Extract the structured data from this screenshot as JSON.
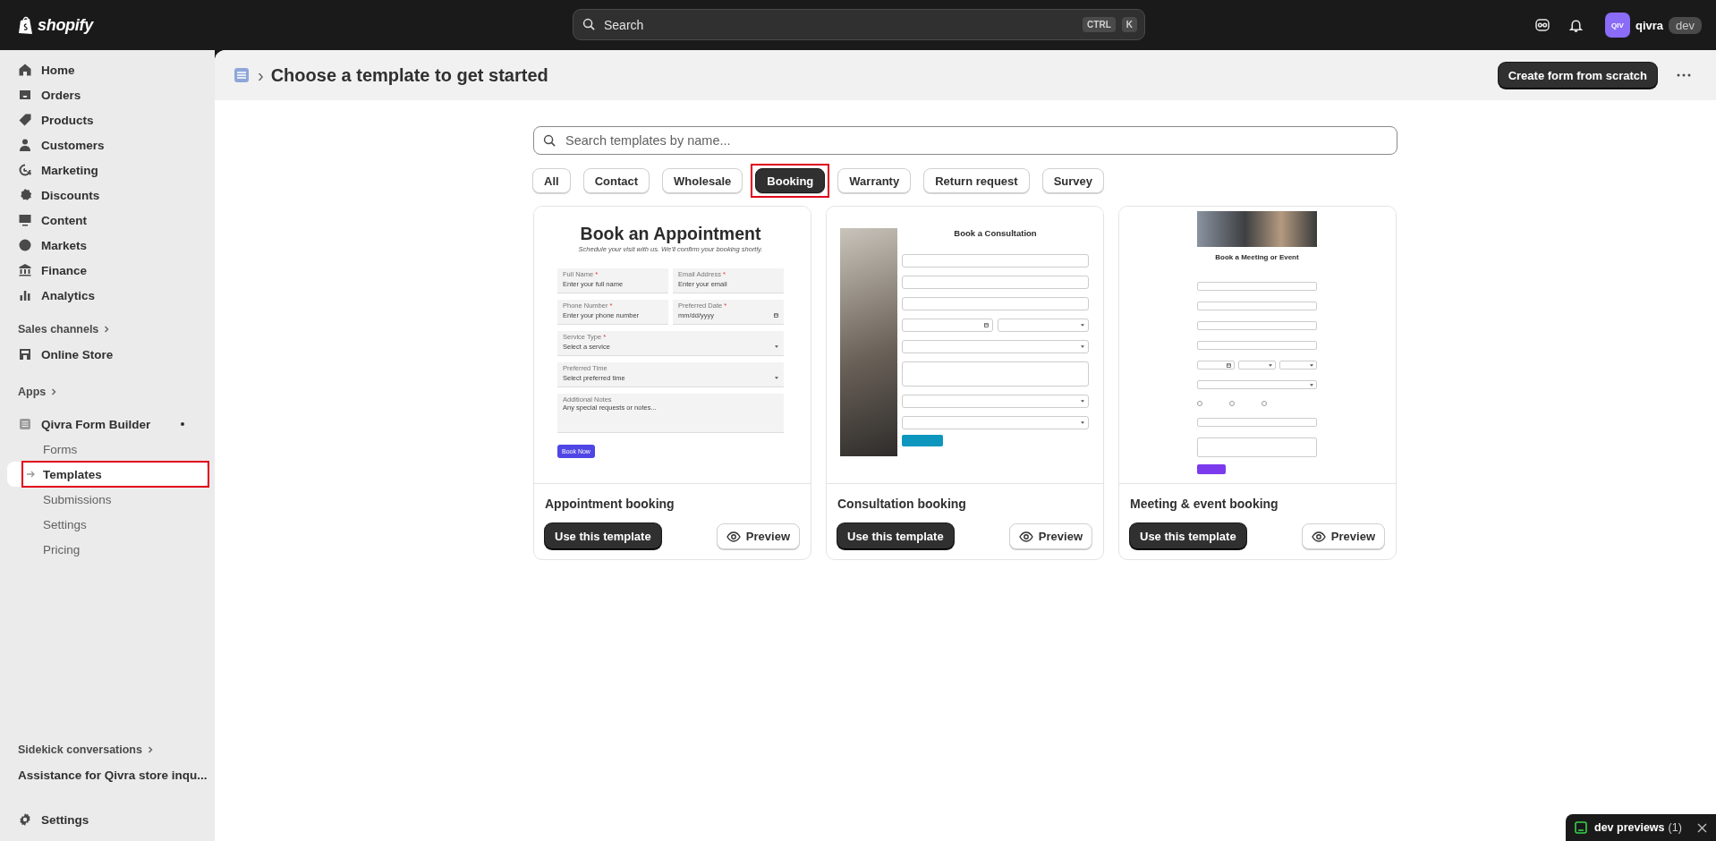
{
  "topbar": {
    "brand": "shopify",
    "search": {
      "placeholder": "Search",
      "keys": [
        "CTRL",
        "K"
      ]
    },
    "avatar": "QIV",
    "store": "qivra",
    "store_badge": "dev"
  },
  "sidebar": {
    "nav": [
      {
        "label": "Home",
        "selected": false
      },
      {
        "label": "Orders",
        "selected": false
      },
      {
        "label": "Products",
        "selected": false
      },
      {
        "label": "Customers",
        "selected": false
      },
      {
        "label": "Marketing",
        "selected": false
      },
      {
        "label": "Discounts",
        "selected": false
      },
      {
        "label": "Content",
        "selected": false
      },
      {
        "label": "Markets",
        "selected": false
      },
      {
        "label": "Finance",
        "selected": false
      },
      {
        "label": "Analytics",
        "selected": false
      }
    ],
    "sales_channels": {
      "heading": "Sales channels",
      "items": [
        {
          "label": "Online Store",
          "selected": false
        }
      ]
    },
    "apps": {
      "heading": "Apps",
      "app": {
        "label": "Qivra Form Builder",
        "pinned": true,
        "children": [
          {
            "label": "Forms",
            "selected": false,
            "highlighted": false
          },
          {
            "label": "Templates",
            "selected": true,
            "highlighted": true
          },
          {
            "label": "Submissions",
            "selected": false,
            "highlighted": false
          },
          {
            "label": "Settings",
            "selected": false,
            "highlighted": false
          },
          {
            "label": "Pricing",
            "selected": false,
            "highlighted": false
          }
        ]
      }
    },
    "sidekick": {
      "heading": "Sidekick conversations",
      "items": [
        "Assistance for Qivra store inqu..."
      ]
    },
    "settings": "Settings"
  },
  "page": {
    "breadcrumb_separator": "›",
    "title": "Choose a template to get started",
    "primary_action": "Create form from scratch"
  },
  "search": {
    "placeholder": "Search templates by name..."
  },
  "filters": [
    {
      "label": "All",
      "selected": false,
      "highlighted": false
    },
    {
      "label": "Contact",
      "selected": false,
      "highlighted": false
    },
    {
      "label": "Wholesale",
      "selected": false,
      "highlighted": false
    },
    {
      "label": "Booking",
      "selected": true,
      "highlighted": true
    },
    {
      "label": "Warranty",
      "selected": false,
      "highlighted": false
    },
    {
      "label": "Return request",
      "selected": false,
      "highlighted": false
    },
    {
      "label": "Survey",
      "selected": false,
      "highlighted": false
    }
  ],
  "templates": [
    {
      "name": "Appointment booking",
      "use_label": "Use this template",
      "preview_label": "Preview",
      "preview": {
        "kind": "filled",
        "title": "Book an Appointment",
        "subtitle": "Schedule your visit with us. We'll confirm your booking shortly.",
        "rows": [
          [
            {
              "kind": "input",
              "label": "Full Name",
              "mark": "*",
              "placeholder": "Enter your full name"
            },
            {
              "kind": "input",
              "label": "Email Address",
              "mark": "*",
              "placeholder": "Enter your email"
            }
          ],
          [
            {
              "kind": "input",
              "label": "Phone Number",
              "mark": "*",
              "placeholder": "Enter your phone number"
            },
            {
              "kind": "date",
              "label": "Preferred Date",
              "mark": "*",
              "placeholder": "mm/dd/yyyy"
            }
          ],
          [
            {
              "kind": "select",
              "label": "Service Type",
              "mark": "*",
              "placeholder": "Select a service"
            }
          ],
          [
            {
              "kind": "select",
              "label": "Preferred Time",
              "placeholder": "Select preferred time"
            }
          ],
          [
            {
              "kind": "textarea",
              "label": "Additional Notes",
              "placeholder": "Any special requests or notes..."
            }
          ]
        ],
        "button": {
          "label": "Book Now",
          "color": "#4f46e5"
        }
      }
    },
    {
      "name": "Consultation booking",
      "use_label": "Use this template",
      "preview_label": "Preview",
      "preview": {
        "kind": "side_photo",
        "title": "Book a Consultation",
        "rows": [
          [
            {
              "kind": "input"
            }
          ],
          [
            {
              "kind": "input"
            }
          ],
          [
            {
              "kind": "input"
            }
          ],
          [
            {
              "kind": "date"
            },
            {
              "kind": "select"
            }
          ],
          [
            {
              "kind": "select"
            }
          ],
          [
            {
              "kind": "textarea"
            }
          ],
          [
            {
              "kind": "select"
            }
          ],
          [
            {
              "kind": "select"
            }
          ]
        ],
        "button": {
          "color": "#0e97be"
        }
      }
    },
    {
      "name": "Meeting & event booking",
      "use_label": "Use this template",
      "preview_label": "Preview",
      "preview": {
        "kind": "top_photo",
        "title": "Book a Meeting or Event",
        "rows": [
          [
            {
              "kind": "input"
            }
          ],
          [
            {
              "kind": "input"
            }
          ],
          [
            {
              "kind": "input"
            }
          ],
          [
            {
              "kind": "input"
            }
          ],
          [
            {
              "kind": "date"
            },
            {
              "kind": "select"
            },
            {
              "kind": "select"
            }
          ],
          [
            {
              "kind": "select"
            }
          ],
          [
            {
              "kind": "radio",
              "options": [
                {
                  "selected": false
                },
                {
                  "selected": false
                },
                {
                  "selected": false
                }
              ]
            }
          ],
          [
            {
              "kind": "input"
            }
          ],
          [
            {
              "kind": "textarea"
            }
          ]
        ],
        "button": {
          "color": "#7c3aed"
        }
      }
    }
  ],
  "dev_previews": {
    "label": "dev previews",
    "count": "(1)"
  }
}
